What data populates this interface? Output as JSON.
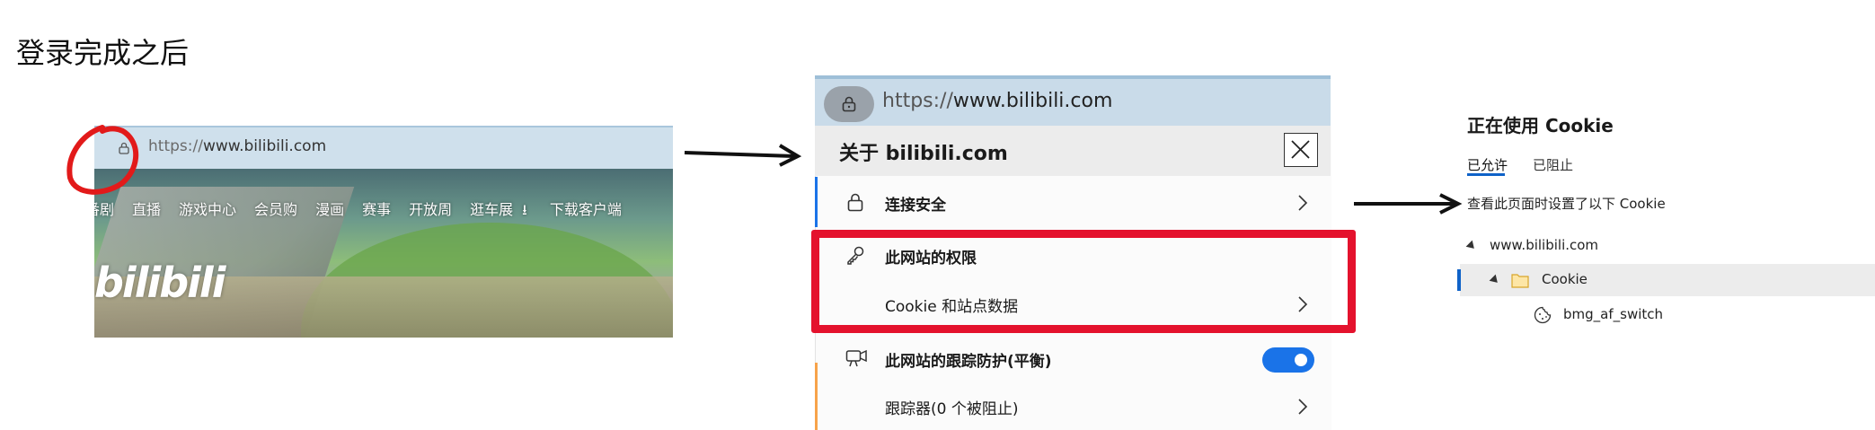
{
  "heading": "登录完成之后",
  "panel1": {
    "url_prefix": "https://",
    "url_domain": "www.bilibili.com",
    "nav": [
      "番剧",
      "直播",
      "游戏中心",
      "会员购",
      "漫画",
      "赛事",
      "开放周",
      "逛车展",
      "下载客户端"
    ],
    "logo_text": "bilibili"
  },
  "panel2": {
    "url_prefix": "https://",
    "url_domain": "www.bilibili.com",
    "title": "关于 bilibili.com",
    "rows": {
      "connection": "连接安全",
      "permissions": "此网站的权限",
      "cookies": "Cookie 和站点数据",
      "tracking": "此网站的跟踪防护(平衡)",
      "trackers": "跟踪器(0 个被阻止)"
    },
    "tracking_toggle_on": true
  },
  "panel3": {
    "title": "正在使用 Cookie",
    "tab_allowed": "已允许",
    "tab_blocked": "已阻止",
    "description": "查看此页面时设置了以下 Cookie",
    "tree": {
      "domain": "www.bilibili.com",
      "folder": "Cookie",
      "cookie": "bmg_af_switch"
    }
  },
  "colors": {
    "highlight_red": "#e4122d",
    "toggle_blue": "#1a73e8",
    "tab_underline": "#0f62c8"
  },
  "icons": {
    "lock": "lock-icon",
    "key": "key-icon",
    "chevron": "chevron-right-icon",
    "close": "close-icon",
    "camera": "tracking-prevention-icon",
    "folder": "folder-icon",
    "cookie": "cookie-icon",
    "download": "download-icon"
  }
}
